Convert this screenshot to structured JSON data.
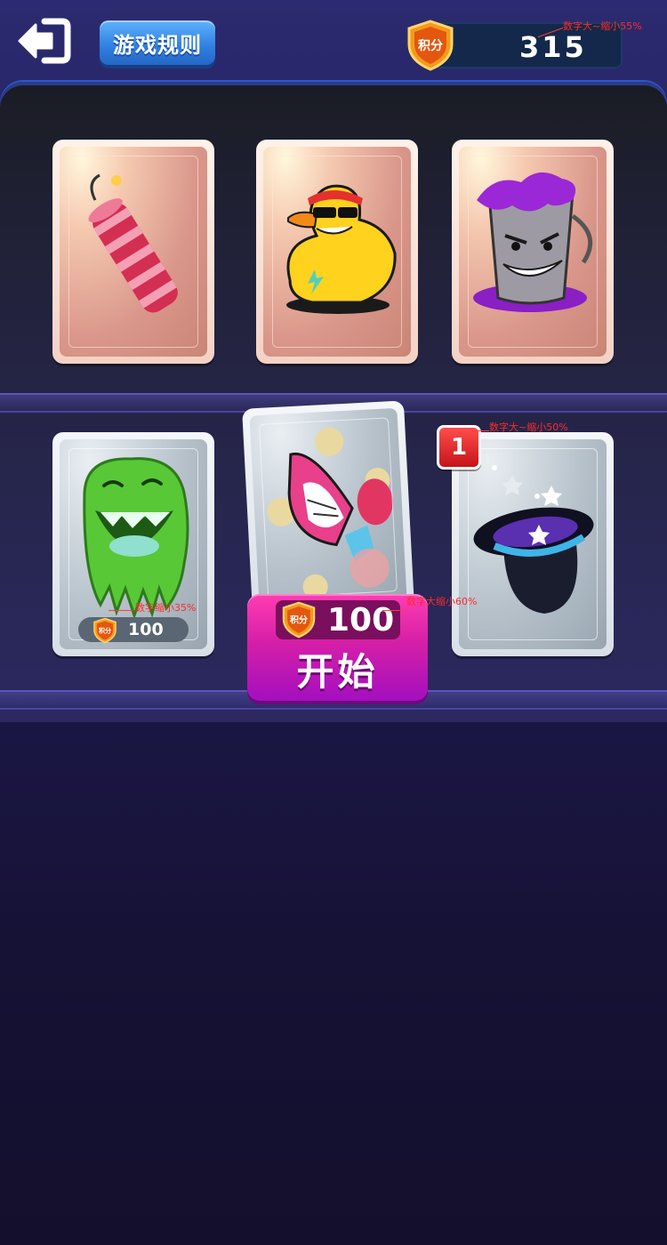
{
  "header": {
    "rules_label": "游戏规则",
    "score": "315",
    "score_badge": "积分",
    "score_annotation": "数字大~缩小55%"
  },
  "items": [
    {
      "name": "firecracker"
    },
    {
      "name": "cool-duck"
    },
    {
      "name": "paint-bucket"
    },
    {
      "name": "green-slime",
      "price": "100",
      "price_badge": "积分",
      "annotation": "数字缩小35%"
    },
    {
      "name": "rocket",
      "selected": true
    },
    {
      "name": "magic-hat",
      "count": "1",
      "annotation": "数字大~缩小50%"
    }
  ],
  "start": {
    "price": "100",
    "price_badge": "积分",
    "label": "开始",
    "annotation": "数字大缩小60%"
  },
  "colors": {
    "start_button": "#d61fa7",
    "rules_button": "#2f7fe0",
    "badge_red": "#e0221f",
    "shield_orange": "#f39a1e"
  }
}
